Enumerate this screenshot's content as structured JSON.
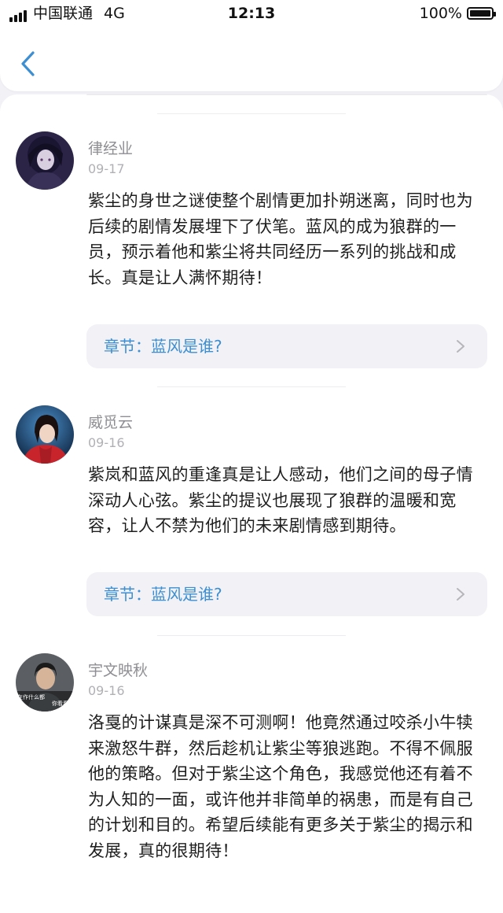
{
  "status_bar": {
    "carrier": "中国联通",
    "network": "4G",
    "time": "12:13",
    "battery": "100%"
  },
  "nav": {
    "back_icon": "chevron-left-icon"
  },
  "colors": {
    "accent": "#3d8fd1",
    "meta": "#8e8e93",
    "background": "#f2f2f6"
  },
  "comments": [
    {
      "username": "律经业",
      "date": "09-17",
      "content": "紫尘的身世之谜使整个剧情更加扑朔迷离，同时也为后续的剧情发展埋下了伏笔。蓝风的成为狼群的一员，预示着他和紫尘将共同经历一系列的挑战和成长。真是让人满怀期待！",
      "chapter": "章节：蓝风是谁?"
    },
    {
      "username": "威觅云",
      "date": "09-16",
      "content": "紫岚和蓝风的重逢真是让人感动，他们之间的母子情深动人心弦。紫尘的提议也展现了狼群的温暖和宽容，让人不禁为他们的未来剧情感到期待。",
      "chapter": "章节：蓝风是谁?"
    },
    {
      "username": "宇文映秋",
      "date": "09-16",
      "content": "洛戛的计谋真是深不可测啊！他竟然通过咬杀小牛犊来激怒牛群，然后趁机让紫尘等狼逃跑。不得不佩服他的策略。但对于紫尘这个角色，我感觉他还有着不为人知的一面，或许他并非简单的祸患，而是有自己的计划和目的。希望后续能有更多关于紫尘的揭示和发展，真的很期待！",
      "avatar_text_left": "在作什么都",
      "avatar_text_right": "你看看"
    }
  ]
}
